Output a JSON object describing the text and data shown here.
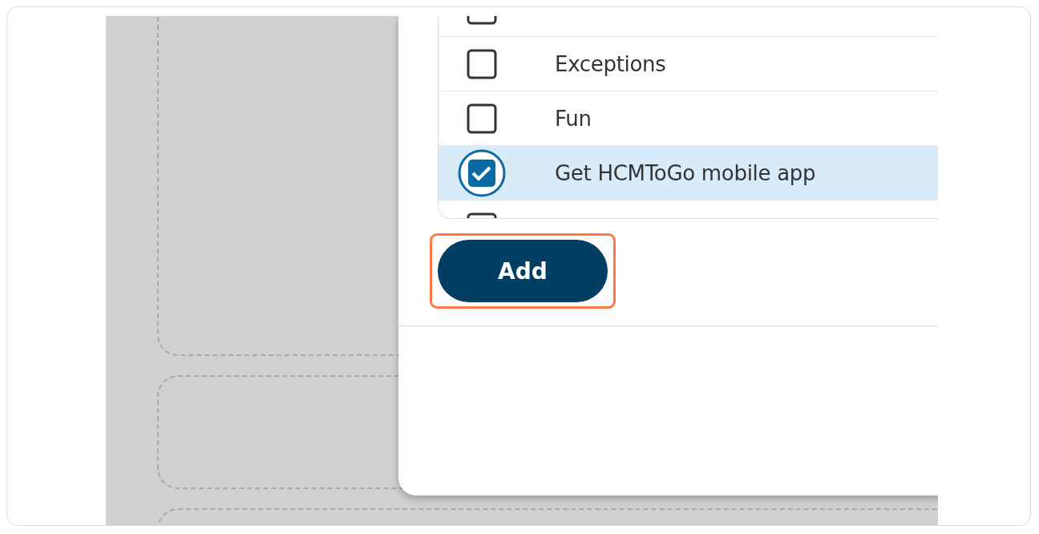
{
  "list": {
    "items": [
      {
        "kind": "clipped",
        "checked": false
      },
      {
        "kind": "row",
        "label": "Exceptions",
        "checked": false,
        "selected": false
      },
      {
        "kind": "row",
        "label": "Fun",
        "checked": false,
        "selected": false
      },
      {
        "kind": "row",
        "label": "Get HCMToGo mobile app",
        "checked": true,
        "selected": true
      },
      {
        "kind": "clipped",
        "checked": false
      }
    ]
  },
  "add_button": {
    "label": "Add",
    "highlighted": true
  }
}
